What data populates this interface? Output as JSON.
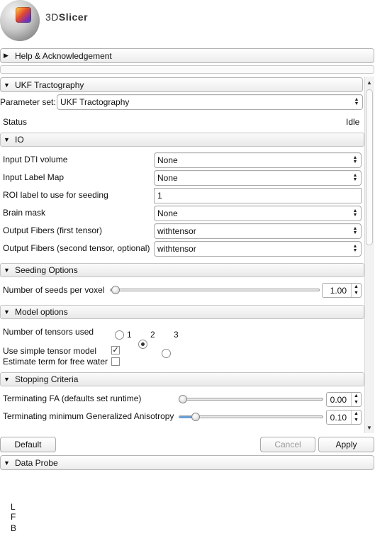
{
  "app": {
    "logo_text_light": "3D",
    "logo_text_bold": "Slicer"
  },
  "help": {
    "label": "Help & Acknowledgement"
  },
  "module": {
    "label": "UKF Tractography"
  },
  "parameter_set": {
    "label": "Parameter set:",
    "value": "UKF Tractography"
  },
  "status": {
    "label": "Status",
    "value": "Idle"
  },
  "io": {
    "label": "IO",
    "rows": [
      {
        "label": "Input DTI volume",
        "value": "None"
      },
      {
        "label": "Input Label Map",
        "value": "None"
      },
      {
        "label": "ROI label to use for seeding",
        "value": "1"
      },
      {
        "label": "Brain mask",
        "value": "None"
      },
      {
        "label": "Output Fibers (first tensor)",
        "value": "withtensor"
      },
      {
        "label": "Output Fibers (second tensor, optional)",
        "value": "withtensor"
      }
    ]
  },
  "seeding": {
    "label": "Seeding Options",
    "seeds_label": "Number of seeds per voxel",
    "seeds_value": "1.00",
    "seeds_slider_fraction": 0.02
  },
  "model": {
    "label": "Model options",
    "tensors_label": "Number of tensors used",
    "tensor_options": [
      "1",
      "2",
      "3"
    ],
    "tensor_selected": "2",
    "simple_label": "Use simple tensor model",
    "simple_checked": true,
    "freewater_label": "Estimate term for free water",
    "freewater_checked": false
  },
  "stopping": {
    "label": "Stopping Criteria",
    "fa_label": "Terminating FA (defaults set runtime)",
    "fa_value": "0.00",
    "ga_label": "Terminating minimum Generalized Anisotropy",
    "ga_value": "0.10"
  },
  "buttons": {
    "default": "Default",
    "cancel": "Cancel",
    "apply": "Apply"
  },
  "data_probe": {
    "label": "Data Probe"
  },
  "orientation": {
    "l": "L",
    "f": "F",
    "b": "B"
  }
}
